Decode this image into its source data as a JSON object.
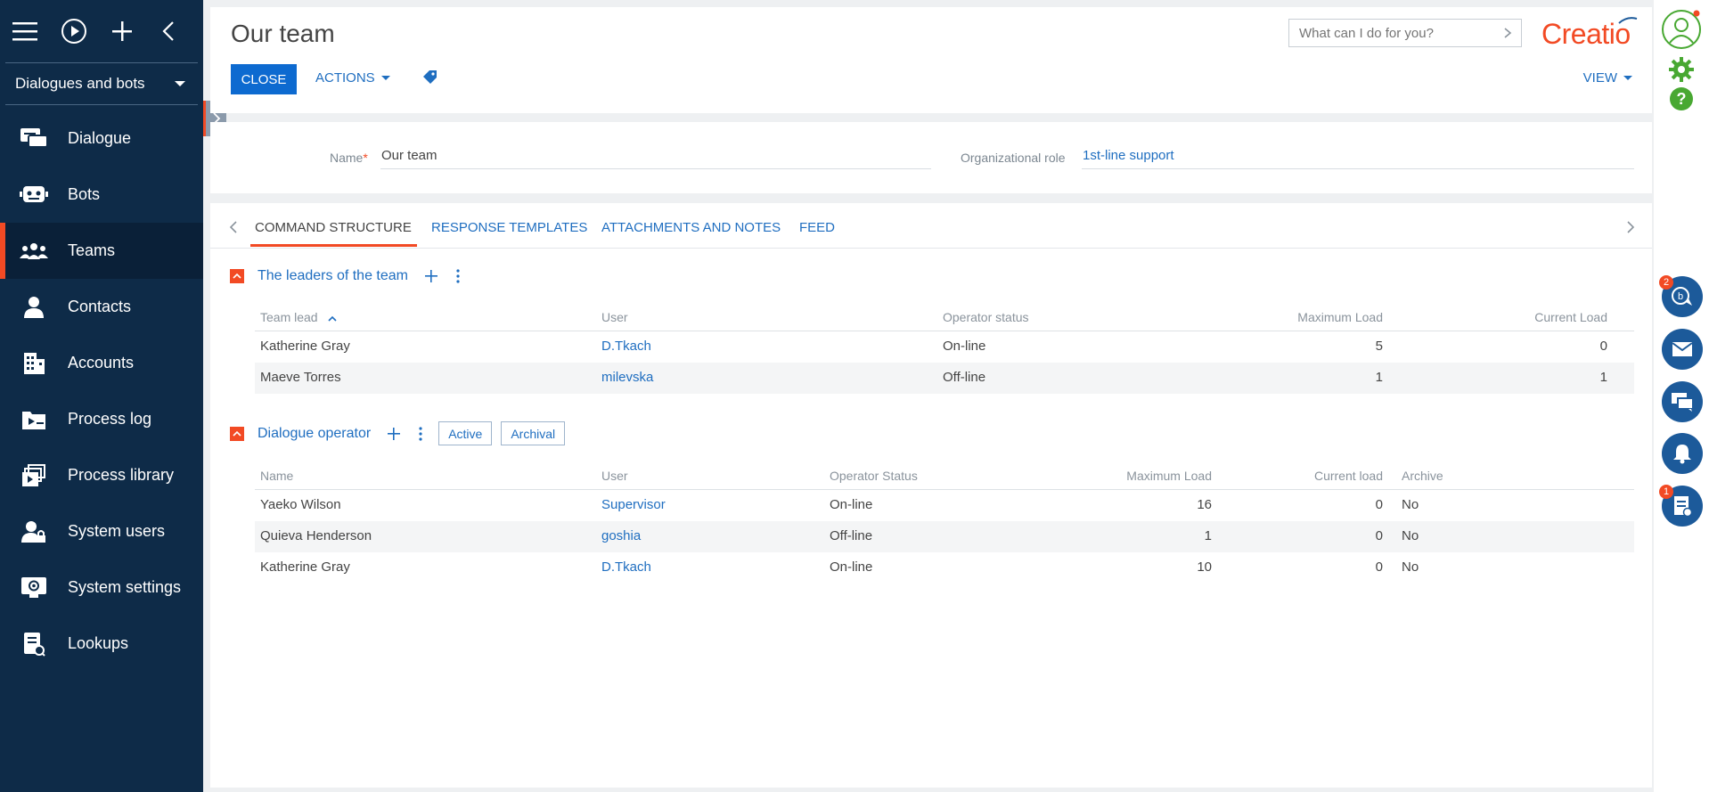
{
  "sidebar": {
    "workspace": "Dialogues and bots",
    "items": [
      {
        "label": "Dialogue",
        "icon": "dialogue-icon"
      },
      {
        "label": "Bots",
        "icon": "bot-icon"
      },
      {
        "label": "Teams",
        "icon": "teams-icon",
        "active": true
      },
      {
        "label": "Contacts",
        "icon": "contact-icon"
      },
      {
        "label": "Accounts",
        "icon": "accounts-icon"
      },
      {
        "label": "Process log",
        "icon": "process-log-icon"
      },
      {
        "label": "Process library",
        "icon": "process-library-icon"
      },
      {
        "label": "System users",
        "icon": "system-users-icon"
      },
      {
        "label": "System settings",
        "icon": "system-settings-icon"
      },
      {
        "label": "Lookups",
        "icon": "lookups-icon"
      }
    ]
  },
  "header": {
    "title": "Our team",
    "close_label": "CLOSE",
    "actions_label": "ACTIONS",
    "view_label": "VIEW",
    "search_placeholder": "What can I do for you?",
    "logo_text": "Creatio"
  },
  "form": {
    "name_label": "Name",
    "name_required_mark": "*",
    "name_value": "Our team",
    "role_label": "Organizational role",
    "role_value": "1st-line support"
  },
  "tabs": [
    "COMMAND STRUCTURE",
    "RESPONSE TEMPLATES",
    "ATTACHMENTS AND NOTES",
    "FEED"
  ],
  "leaders": {
    "title": "The leaders of the team",
    "columns": [
      "Team lead",
      "User",
      "Operator status",
      "Maximum Load",
      "Current Load"
    ],
    "rows": [
      {
        "name": "Katherine Gray",
        "user": "D.Tkach",
        "status": "On-line",
        "max": "5",
        "current": "0"
      },
      {
        "name": "Maeve Torres",
        "user": "milevska",
        "status": "Off-line",
        "max": "1",
        "current": "1"
      }
    ]
  },
  "operators": {
    "title": "Dialogue operator",
    "filter_active": "Active",
    "filter_archival": "Archival",
    "columns": [
      "Name",
      "User",
      "Operator Status",
      "Maximum Load",
      "Current load",
      "Archive"
    ],
    "rows": [
      {
        "name": "Yaeko Wilson",
        "user": "Supervisor",
        "status": "On-line",
        "max": "16",
        "current": "0",
        "archive": "No"
      },
      {
        "name": "Quieva Henderson",
        "user": "goshia",
        "status": "Off-line",
        "max": "1",
        "current": "0",
        "archive": "No"
      },
      {
        "name": "Katherine Gray",
        "user": "D.Tkach",
        "status": "On-line",
        "max": "10",
        "current": "0",
        "archive": "No"
      }
    ]
  },
  "rail": {
    "chat_badge": "2",
    "tasks_badge": "1"
  },
  "colors": {
    "accent": "#f24a24",
    "link": "#1f6ec0",
    "sidebar": "#0e2b48",
    "primary_button": "#0d6ad0",
    "rail_button": "#1c5a9a",
    "gear": "#48a832"
  }
}
